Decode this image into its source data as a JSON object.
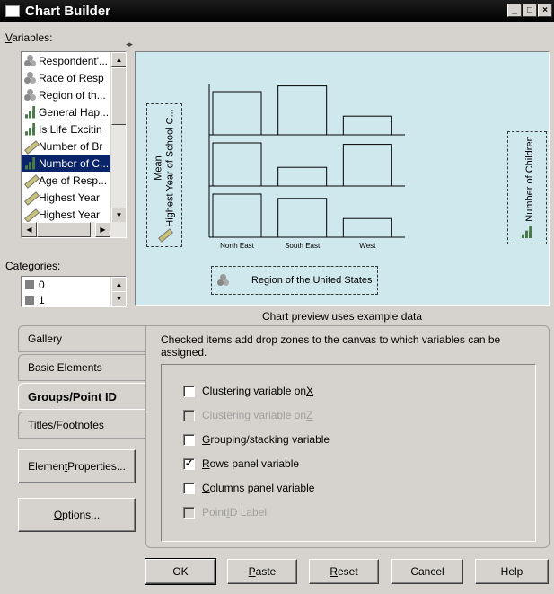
{
  "window": {
    "title": "Chart Builder",
    "controls": [
      "_",
      "□",
      "×"
    ]
  },
  "variables": {
    "label_underline": "V",
    "label_rest": "ariables:",
    "items": [
      {
        "label": "Respondent'...",
        "icon": "nominal-icon"
      },
      {
        "label": "Race of Resp",
        "icon": "nominal-icon"
      },
      {
        "label": "Region of th...",
        "icon": "nominal-icon"
      },
      {
        "label": "General Hap...",
        "icon": "ordinal-icon"
      },
      {
        "label": "Is Life Excitin",
        "icon": "ordinal-icon"
      },
      {
        "label": "Number of Br",
        "icon": "scale-icon"
      },
      {
        "label": "Number of C...",
        "icon": "ordinal-icon",
        "selected": true
      },
      {
        "label": "Age of Resp...",
        "icon": "scale-icon"
      },
      {
        "label": "Highest Year",
        "icon": "scale-icon"
      },
      {
        "label": "Highest Year",
        "icon": "scale-icon"
      }
    ]
  },
  "categories": {
    "label": "Categories:",
    "items": [
      "0",
      "1"
    ]
  },
  "canvas": {
    "y_zone_line1": "Mean",
    "y_zone_line2": "Highest Year of School C...",
    "x_zone": "Region of the United States",
    "rows_zone": "Number of Children",
    "preview_note": "Chart preview uses example data"
  },
  "chart_data": {
    "type": "bar",
    "categories": [
      "North East",
      "South East",
      "West"
    ],
    "panels": [
      {
        "values": [
          3.0,
          3.4,
          1.3
        ]
      },
      {
        "values": [
          3.0,
          1.3,
          2.9
        ]
      },
      {
        "values": [
          3.0,
          2.7,
          1.3
        ]
      }
    ],
    "ylim": [
      0,
      3.5
    ]
  },
  "tabs": [
    {
      "label": "Gallery",
      "active": false
    },
    {
      "label": "Basic Elements",
      "active": false
    },
    {
      "label": "Groups/Point ID",
      "active": true
    },
    {
      "label": "Titles/Footnotes",
      "active": false
    }
  ],
  "side_buttons": {
    "element_properties_pre": "Elemen",
    "element_properties_key": "t",
    "element_properties_post": " Properties...",
    "options_key": "O",
    "options_post": "ptions..."
  },
  "panel": {
    "description": "Checked items add drop zones to the canvas to which variables can be assigned.",
    "options": [
      {
        "pre": "Clustering variable on ",
        "key": "X",
        "post": "",
        "checked": false,
        "disabled": false
      },
      {
        "pre": "Clustering variable on ",
        "key": "Z",
        "post": "",
        "checked": false,
        "disabled": true
      },
      {
        "pre": "",
        "key": "G",
        "post": "rouping/stacking variable",
        "checked": false,
        "disabled": false
      },
      {
        "pre": "",
        "key": "R",
        "post": "ows panel variable",
        "checked": true,
        "disabled": false
      },
      {
        "pre": "",
        "key": "C",
        "post": "olumns panel variable",
        "checked": false,
        "disabled": false
      },
      {
        "pre": "Point ",
        "key": "I",
        "post": "D Label",
        "checked": false,
        "disabled": true
      }
    ]
  },
  "buttons": {
    "ok": "OK",
    "paste_key": "P",
    "paste_post": "aste",
    "reset_key": "R",
    "reset_post": "eset",
    "cancel": "Cancel",
    "help": "Help"
  },
  "colors": {
    "canvas_bg": "#cfe8ee",
    "selection": "#0a246a",
    "bar_fill": "#cfe8ee",
    "bar_stroke": "#000000"
  }
}
